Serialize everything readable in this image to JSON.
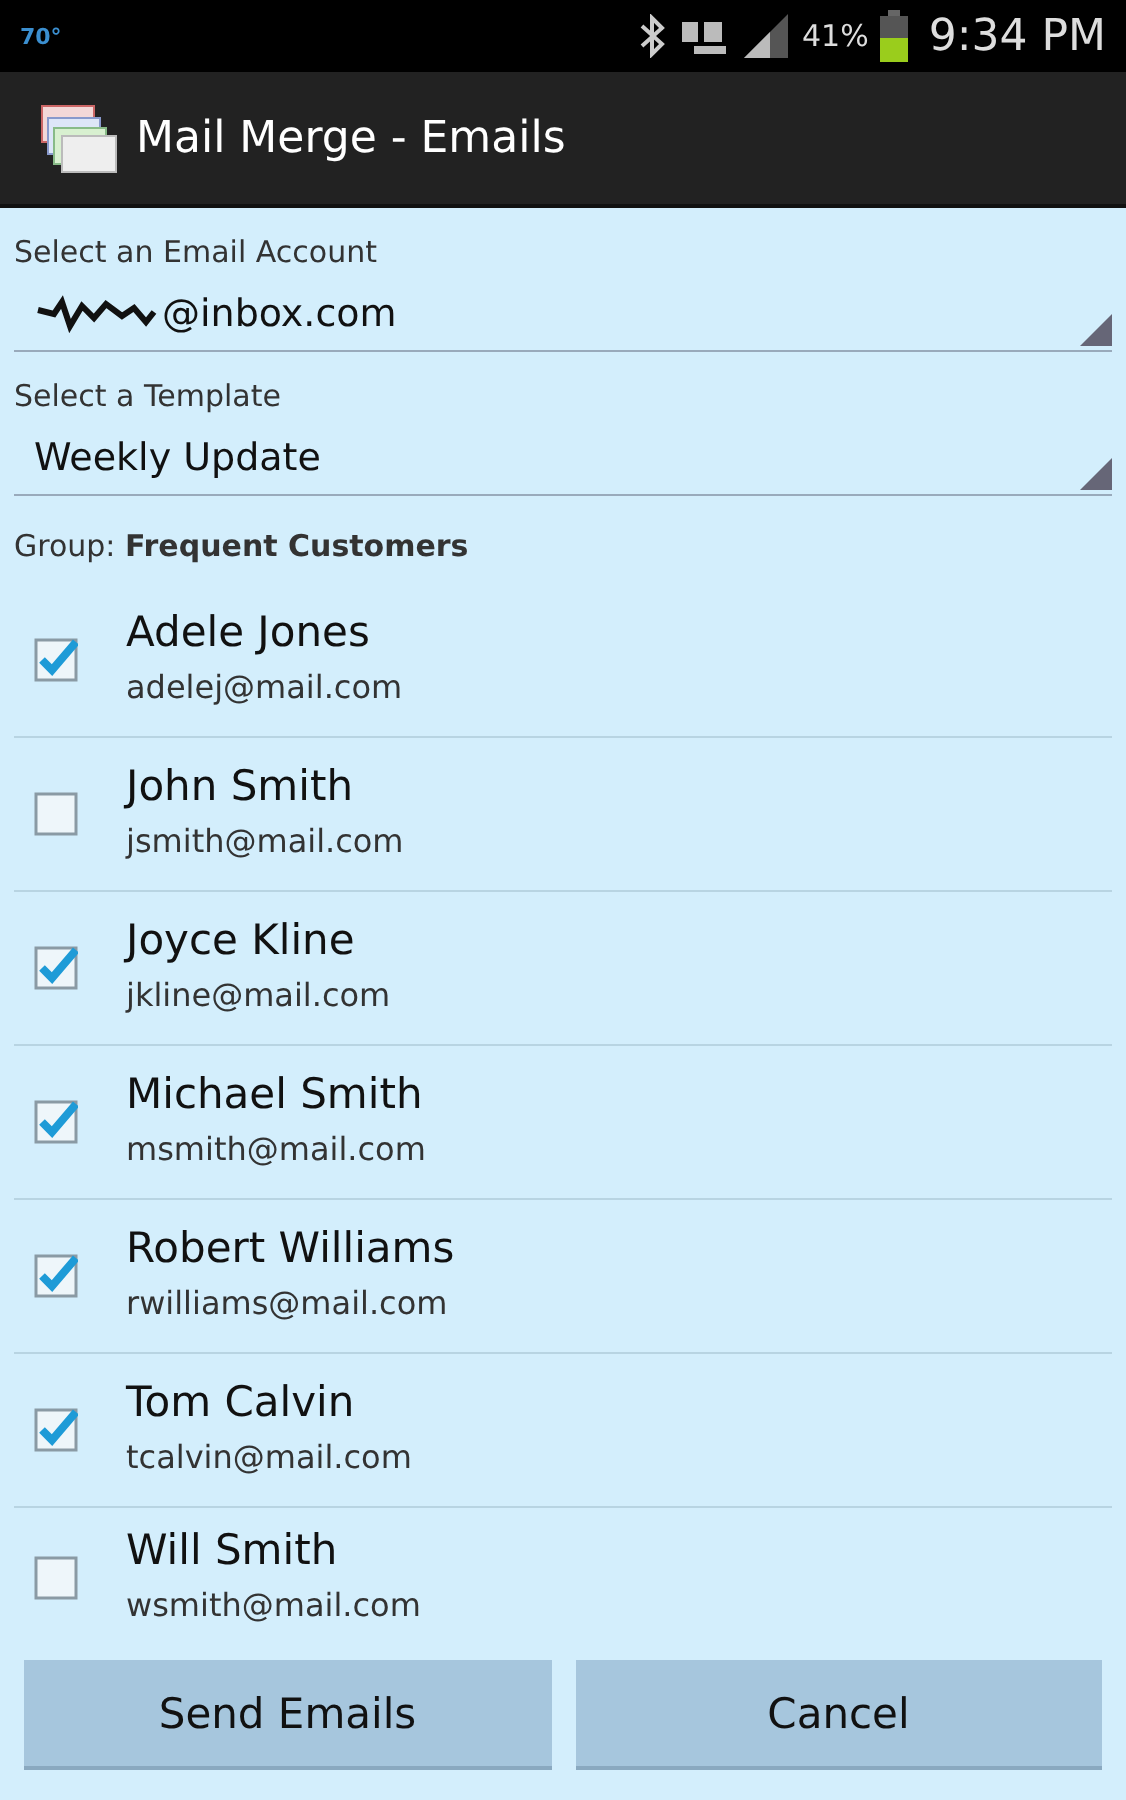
{
  "status_bar": {
    "temperature": "70°",
    "battery": "41%",
    "time": "9:34 PM"
  },
  "action_bar": {
    "title": "Mail Merge - Emails"
  },
  "account": {
    "label": "Select an Email Account",
    "value": "@inbox.com"
  },
  "template": {
    "label": "Select a Template",
    "value": "Weekly Update"
  },
  "group": "Group: **Frequent Customers**",
  "contacts": [
    {
      "name": "Adele Jones",
      "email": "adelej@mail.com",
      "checked": true
    },
    {
      "name": "John Smith",
      "email": "jsmith@mail.com",
      "checked": false
    },
    {
      "name": "Joyce Kline",
      "email": "jkline@mail.com",
      "checked": true
    },
    {
      "name": "Michael Smith",
      "email": "msmith@mail.com",
      "checked": true
    },
    {
      "name": "Robert Williams",
      "email": "rwilliams@mail.com",
      "checked": true
    },
    {
      "name": "Tom Calvin",
      "email": "tcalvin@mail.com",
      "checked": true
    },
    {
      "name": "Will Smith",
      "email": "wsmith@mail.com",
      "checked": false
    }
  ],
  "buttons": [
    "Send Emails",
    "Cancel"
  ]
}
